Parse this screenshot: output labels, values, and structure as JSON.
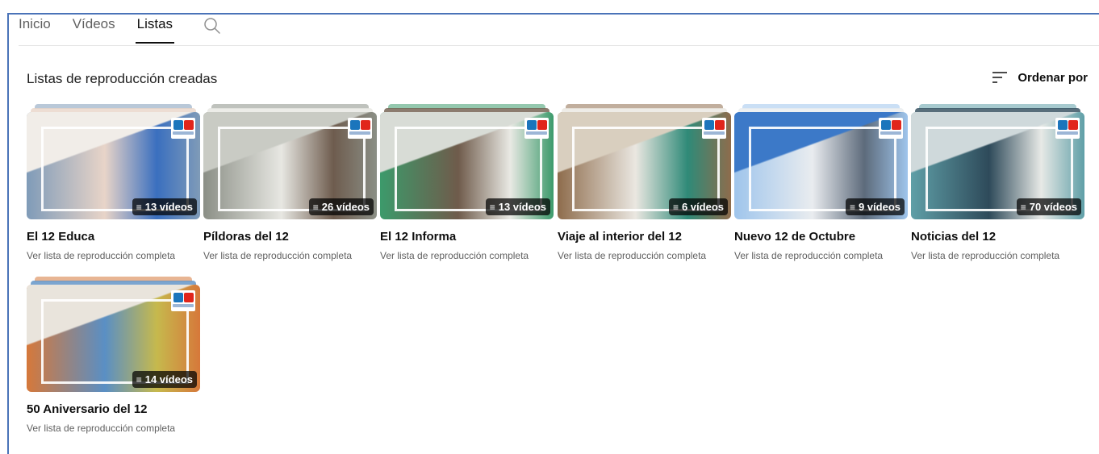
{
  "tabs": [
    {
      "label": "Inicio",
      "active": false
    },
    {
      "label": "Vídeos",
      "active": false
    },
    {
      "label": "Listas",
      "active": true
    }
  ],
  "search_icon": "search-icon",
  "section": {
    "title": "Listas de reproducción creadas",
    "sort_label": "Ordenar por",
    "sort_icon": "sort-icon"
  },
  "playlists": [
    {
      "title": "El 12 Educa",
      "count": "13 vídeos",
      "link": "Ver lista de reproducción completa",
      "colors": [
        "#f1ede8",
        "#7f9bb8",
        "#e8d4c8",
        "#3a6fbf"
      ]
    },
    {
      "title": "Píldoras del 12",
      "count": "26 vídeos",
      "link": "Ver lista de reproducción completa",
      "colors": [
        "#c9cbc4",
        "#8b8f86",
        "#e7e7e2",
        "#6e5c4e"
      ]
    },
    {
      "title": "El 12 Informa",
      "count": "13 vídeos",
      "link": "Ver lista de reproducción completa",
      "colors": [
        "#d8dcd6",
        "#3c9a6b",
        "#6f5b4b",
        "#e9e9e4"
      ]
    },
    {
      "title": "Viaje al interior del 12",
      "count": "6 vídeos",
      "link": "Ver lista de reproducción completa",
      "colors": [
        "#d9cfbf",
        "#8e6c4c",
        "#eae7e1",
        "#2f8a78"
      ]
    },
    {
      "title": "Nuevo 12 de Octubre",
      "count": "9 vídeos",
      "link": "Ver lista de reproducción completa",
      "colors": [
        "#3c79c8",
        "#9fc5ec",
        "#e9ecef",
        "#5d6b7b"
      ]
    },
    {
      "title": "Noticias del 12",
      "count": "70 vídeos",
      "link": "Ver lista de reproducción completa",
      "colors": [
        "#cfd9db",
        "#5f9fa7",
        "#2e4a5a",
        "#e7e9e6"
      ]
    },
    {
      "title": "50 Aniversario del 12",
      "count": "14 vídeos",
      "link": "Ver lista de reproducción completa",
      "colors": [
        "#e9e4dc",
        "#d6783a",
        "#5a8fc4",
        "#c6b94d"
      ]
    }
  ],
  "colors": {
    "accent_border": "#4a73b8",
    "text_primary": "#0f0f0f",
    "text_secondary": "#606060"
  }
}
